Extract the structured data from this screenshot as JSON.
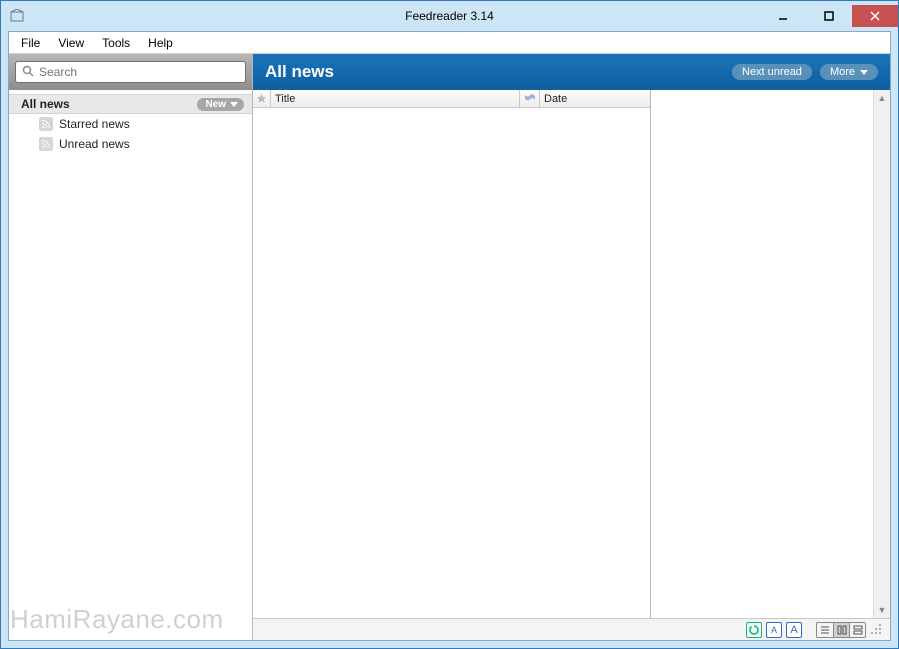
{
  "window": {
    "title": "Feedreader 3.14"
  },
  "menu": {
    "file": "File",
    "view": "View",
    "tools": "Tools",
    "help": "Help"
  },
  "search": {
    "placeholder": "Search"
  },
  "sidebar": {
    "all_news": "All news",
    "new_button": "New",
    "items": [
      {
        "label": "Starred news"
      },
      {
        "label": "Unread news"
      }
    ]
  },
  "header": {
    "title": "All news",
    "next_unread": "Next unread",
    "more": "More"
  },
  "columns": {
    "title": "Title",
    "date": "Date"
  },
  "watermark": "HamiRayane.com"
}
